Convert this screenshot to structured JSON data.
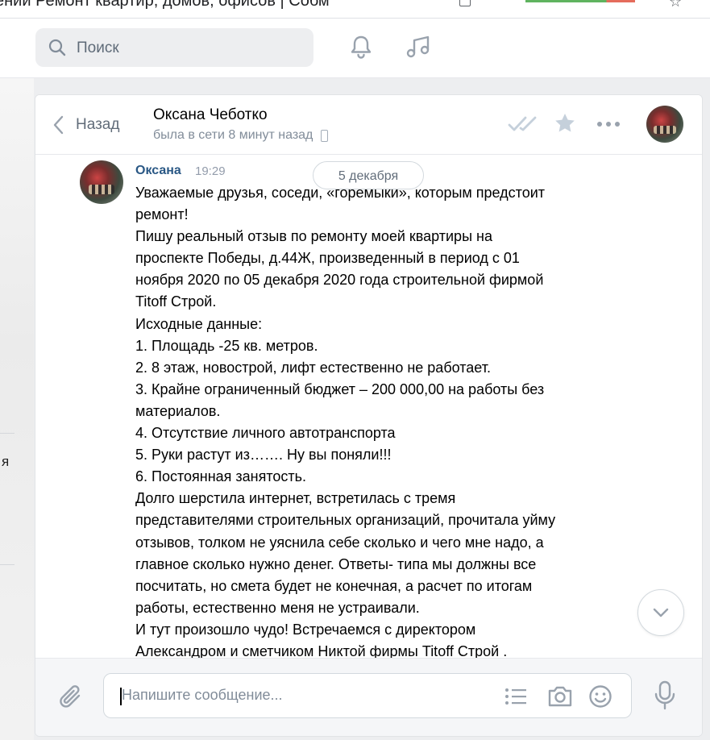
{
  "browser": {
    "tab_title": "ении Ремонт квартир, домов, офисов | Собм"
  },
  "header": {
    "search_placeholder": "Поиск"
  },
  "left_panel": {
    "fragment_text": "я"
  },
  "chat": {
    "back_label": "Назад",
    "peer_name": "Оксана Чеботко",
    "peer_status": "была в сети 8 минут назад",
    "date_separator": "5 декабря",
    "message": {
      "author": "Оксана",
      "time": "19:29",
      "lines": [
        "Уважаемые друзья, соседи, «горемыки», которым предстоит",
        "ремонт!",
        "Пишу реальный отзыв по ремонту моей квартиры на",
        "проспекте Победы, д.44Ж, произведенный в период с 01",
        "ноября 2020 по 05 декабря 2020 года строительной фирмой",
        "Titoff Строй.",
        "Исходные данные:",
        "1. Площадь -25 кв. метров.",
        "2. 8 этаж, новострой, лифт естественно не работает.",
        "3. Крайне ограниченный бюджет – 200 000,00 на работы без",
        "материалов.",
        "4. Отсутствие личного автотранспорта",
        "5. Руки растут из……. Ну вы поняли!!!",
        "6. Постоянная занятость.",
        "Долго шерстила интернет, встретилась с тремя",
        "представителями строительных организаций, прочитала уйму",
        "отзывов, толком не уяснила себе сколько и чего мне надо, а",
        "главное сколько нужно денег. Ответы- типа мы должны все",
        "посчитать, но смета будет не конечная, а расчет по итогам",
        "работы, естественно меня не устраивали.",
        "И тут произошло чудо! Встречаемся с директором",
        "Александром и сметчиком Никтой фирмы Titoff Строй ."
      ]
    },
    "composer": {
      "placeholder": "Напишите сообщение..."
    }
  },
  "colors": {
    "link_blue": "#2a5885",
    "icon_gray": "#99a2ad",
    "page_bg": "#edeef0"
  }
}
